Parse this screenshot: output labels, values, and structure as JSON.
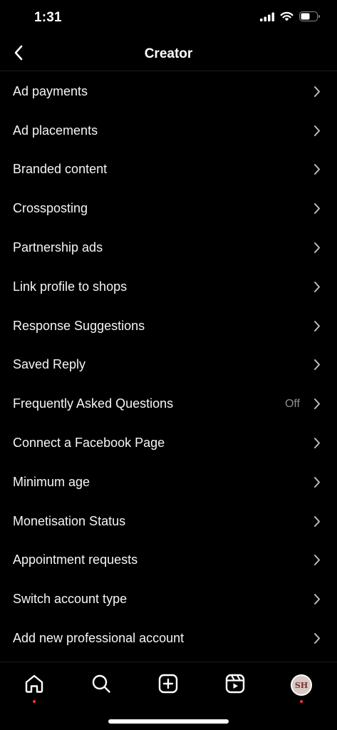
{
  "status": {
    "time": "1:31"
  },
  "header": {
    "title": "Creator"
  },
  "menu": {
    "items": [
      {
        "label": "Ad payments",
        "value": ""
      },
      {
        "label": "Ad placements",
        "value": ""
      },
      {
        "label": "Branded content",
        "value": ""
      },
      {
        "label": "Crossposting",
        "value": ""
      },
      {
        "label": "Partnership ads",
        "value": ""
      },
      {
        "label": "Link profile to shops",
        "value": ""
      },
      {
        "label": "Response Suggestions",
        "value": ""
      },
      {
        "label": "Saved Reply",
        "value": ""
      },
      {
        "label": "Frequently Asked Questions",
        "value": "Off"
      },
      {
        "label": "Connect a Facebook Page",
        "value": ""
      },
      {
        "label": "Minimum age",
        "value": ""
      },
      {
        "label": "Monetisation Status",
        "value": ""
      },
      {
        "label": "Appointment requests",
        "value": ""
      },
      {
        "label": "Switch account type",
        "value": ""
      },
      {
        "label": "Add new professional account",
        "value": ""
      }
    ]
  },
  "tabbar": {
    "avatar_initials": "SH"
  },
  "colors": {
    "background": "#000000",
    "text": "#ffffff",
    "secondary": "#8e8e8e",
    "notification": "#ff3040"
  }
}
